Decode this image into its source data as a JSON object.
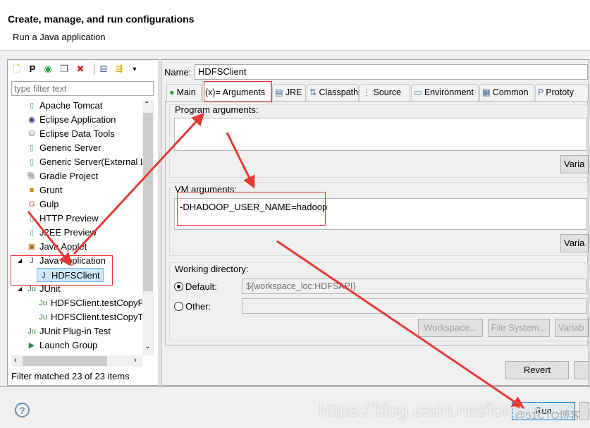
{
  "header": {
    "title": "Create, manage, and run configurations",
    "subtitle": "Run a Java application"
  },
  "toolbar": {
    "icons": [
      "new-config-icon",
      "new-prototype-icon",
      "export-icon",
      "duplicate-icon",
      "delete-icon",
      "collapse-all-icon",
      "filter-icon",
      "menu-dropdown-icon"
    ]
  },
  "filter": {
    "placeholder": "type filter text"
  },
  "tree": [
    {
      "label": "Apache Tomcat",
      "icon": "server-icon"
    },
    {
      "label": "Eclipse Application",
      "icon": "eclipse-icon"
    },
    {
      "label": "Eclipse Data Tools",
      "icon": "database-icon"
    },
    {
      "label": "Generic Server",
      "icon": "server-icon"
    },
    {
      "label": "Generic Server(External L",
      "icon": "server-icon"
    },
    {
      "label": "Gradle Project",
      "icon": "gradle-icon"
    },
    {
      "label": "Grunt",
      "icon": "grunt-icon"
    },
    {
      "label": "Gulp",
      "icon": "gulp-icon"
    },
    {
      "label": "HTTP Preview",
      "icon": "server-icon"
    },
    {
      "label": "J2EE Preview",
      "icon": "server-icon"
    },
    {
      "label": "Java Applet",
      "icon": "applet-icon"
    },
    {
      "label": "Java Application",
      "icon": "java-app-icon",
      "expanded": true
    },
    {
      "label": "HDFSClient",
      "icon": "java-app-icon",
      "child": true,
      "selected": true
    },
    {
      "label": "JUnit",
      "icon": "junit-icon",
      "expanded": true
    },
    {
      "label": "HDFSClient.testCopyFr",
      "icon": "junit-icon",
      "child": true
    },
    {
      "label": "HDFSClient.testCopyTo",
      "icon": "junit-icon",
      "child": true
    },
    {
      "label": "JUnit Plug-in Test",
      "icon": "junit-plugin-icon"
    },
    {
      "label": "Launch Group",
      "icon": "launch-group-icon"
    }
  ],
  "status": "Filter matched 23 of 23 items",
  "name": {
    "label": "Name:",
    "value": "HDFSClient"
  },
  "tabs": [
    {
      "label": "Main",
      "icon": "main-icon"
    },
    {
      "label": "(x)= Arguments",
      "active": true
    },
    {
      "label": "JRE",
      "icon": "jre-icon"
    },
    {
      "label": "Classpath",
      "icon": "classpath-icon"
    },
    {
      "label": "Source",
      "icon": "source-icon"
    },
    {
      "label": "Environment",
      "icon": "environment-icon"
    },
    {
      "label": "Common",
      "icon": "common-icon"
    },
    {
      "label": "Prototy",
      "icon": "prototype-icon"
    }
  ],
  "arguments": {
    "program_label": "Program arguments:",
    "program_value": "",
    "variables": "Varia",
    "vm_label": "VM arguments:",
    "vm_value": "-DHADOOP_USER_NAME=hadoop",
    "vm_variables": "Varia",
    "workdir_label": "Working directory:",
    "default_label": "Default:",
    "default_value": "${workspace_loc:HDFSAPI}",
    "other_label": "Other:",
    "other_value": "",
    "workspace": "Workspace...",
    "filesystem": "File System...",
    "variables2": "Variab"
  },
  "buttons": {
    "revert": "Revert",
    "run": "Run"
  },
  "watermark": {
    "url": "https://blog.csdn.net/forever428",
    "logo": "@51CTO博客"
  },
  "colors": {
    "annotation": "#e53935",
    "selection": "#cce8ff",
    "accent": "#0078d7"
  }
}
